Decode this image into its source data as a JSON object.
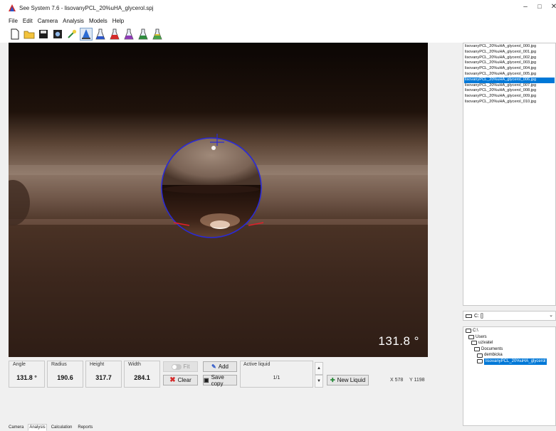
{
  "window": {
    "title": "See System 7.6 - lisovanyPCL_20%uHA_glycerol.spj",
    "controls": {
      "minimize": "–",
      "maximize": "□",
      "close": "✕"
    }
  },
  "menu": [
    "File",
    "Edit",
    "Camera",
    "Analysis",
    "Models",
    "Help"
  ],
  "toolbar": {
    "icons": [
      "new-file-icon",
      "open-folder-icon",
      "save-disk-icon",
      "camera-icon",
      "wand-icon",
      "analysis-drop-icon",
      "flask-blue-icon",
      "flask-red-icon",
      "flask-mixed-icon",
      "flask-green-icon",
      "flask-yellow-icon"
    ],
    "active_index": 5
  },
  "viewport": {
    "angle_overlay": "131.8 °"
  },
  "measurements": {
    "angle": {
      "label": "Angle",
      "value": "131.8 °"
    },
    "radius": {
      "label": "Radius",
      "value": "190.6"
    },
    "height": {
      "label": "Height",
      "value": "317.7"
    },
    "width": {
      "label": "Width",
      "value": "284.1"
    }
  },
  "buttons": {
    "fit": "Fit",
    "add": "Add",
    "clear": "Clear",
    "save_copy": "Save copy",
    "new_liquid": "New Liquid"
  },
  "liquid": {
    "label": "Active liquid",
    "value": "1/1"
  },
  "coords": {
    "x": "X 578",
    "y": "Y 1198"
  },
  "files": {
    "items": [
      "lisovanyPCL_20%uHA_glycerol_000.jpg",
      "lisovanyPCL_20%uHA_glycerol_001.jpg",
      "lisovanyPCL_20%uHA_glycerol_002.jpg",
      "lisovanyPCL_20%uHA_glycerol_003.jpg",
      "lisovanyPCL_20%uHA_glycerol_004.jpg",
      "lisovanyPCL_20%uHA_glycerol_005.jpg",
      "lisovanyPCL_20%uHA_glycerol_006.jpg",
      "lisovanyPCL_20%uHA_glycerol_007.jpg",
      "lisovanyPCL_20%uHA_glycerol_008.jpg",
      "lisovanyPCL_20%uHA_glycerol_009.jpg",
      "lisovanyPCL_20%uHA_glycerol_010.jpg"
    ],
    "selected_index": 6
  },
  "drive": {
    "value": "C: []",
    "dropdown": "⌄"
  },
  "tree": {
    "items": [
      "C:\\",
      "Users",
      "uzivatel",
      "Documents",
      "dembicka",
      "lisovanyPCL_20%uHA_glycerol"
    ],
    "selected_index": 5
  },
  "tabs": {
    "items": [
      "Camera",
      "Analysis",
      "Calculation",
      "Reports"
    ],
    "active_index": 1
  },
  "colors": {
    "selection": "#0078d7",
    "circle": "#2a2ad6",
    "contact_mark": "#e0202a"
  }
}
